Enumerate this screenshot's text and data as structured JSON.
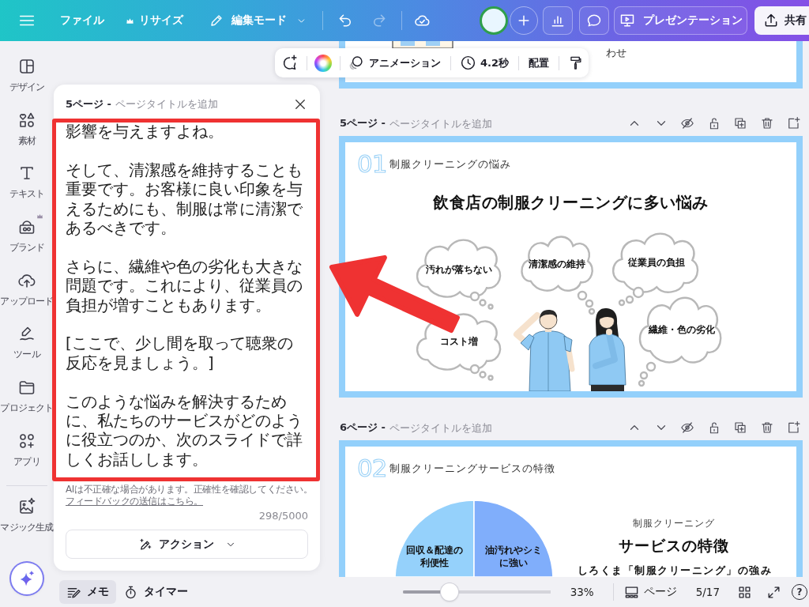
{
  "top_bar": {
    "file_menu": "ファイル",
    "resize_menu": {
      "label": "リサイズ",
      "premium": true
    },
    "edit_mode": "編集モード",
    "undo": {
      "disabled": false
    },
    "redo": {
      "disabled": true
    },
    "present_button": "プレゼンテーション",
    "share_button": "共有"
  },
  "floating_toolbar": {
    "animation": "アニメーション",
    "duration": "4.2秒",
    "position": "配置"
  },
  "sidebar": {
    "items": [
      {
        "label": "デザイン",
        "premium": false
      },
      {
        "label": "素材",
        "premium": false
      },
      {
        "label": "テキスト",
        "premium": false
      },
      {
        "label": "ブランド",
        "premium": true
      },
      {
        "label": "アップロード",
        "premium": false
      },
      {
        "label": "ツール",
        "premium": false
      },
      {
        "label": "プロジェクト",
        "premium": false
      },
      {
        "label": "アプリ",
        "premium": false
      }
    ],
    "ai_items": [
      {
        "label": "マジック生成",
        "premium": false
      }
    ]
  },
  "notes_panel": {
    "page_label": "5ページ -",
    "title_field": {
      "placeholder": "ページタイトルを追加"
    },
    "highlighted": true,
    "paragraphs": [
      "影響を与えますよね。",
      "そして、清潔感を維持することも重要です。お客様に良い印象を与えるためにも、制服は常に清潔であるべきです。",
      "さらに、繊維や色の劣化も大きな問題です。これにより、従業員の負担が増すこともあります。",
      "[ここで、少し間を取って聴衆の反応を見ましょう。]",
      "このような悩みを解決するために、私たちのサービスがどのように役立つのか、次のスライドで詳しくお話しします。"
    ],
    "disclaimer": "AIは不正確な場合があります。正確性を確認してください。",
    "feedback_link": "フィードバックの送信はこちら。",
    "char_count": "298/5000",
    "action_button": "アクション"
  },
  "canvas": {
    "previous_page": {
      "visible_text": "わせ"
    },
    "pages": [
      {
        "page_label": "5ページ -",
        "title_field": {
          "placeholder": "ページタイトルを追加"
        },
        "slide": {
          "kind": "problems",
          "number": "01",
          "section": "制服クリーニングの悩み",
          "title": "飲食店の制服クリーニングに多い悩み",
          "bubbles": [
            "汚れが落ちない",
            "清潔感の維持",
            "従業員の負担",
            "繊維・色の劣化",
            "コスト増"
          ]
        }
      },
      {
        "page_label": "6ページ -",
        "title_field": {
          "placeholder": "ページタイトルを追加"
        },
        "slide": {
          "kind": "features",
          "number": "02",
          "section": "制服クリーニングサービスの特徴",
          "segments": [
            {
              "label": "回収＆配達の利便性",
              "color": "#95d1fb"
            },
            {
              "label": "油汚れやシミに強い",
              "color": "#80aefb"
            }
          ],
          "eyebrow": "制服クリーニング",
          "heading": "サービスの特徴",
          "subheading": "しろくま「制服クリーニング」の強み"
        }
      }
    ]
  },
  "bottom_bar": {
    "tabs": [
      {
        "label": "メモ",
        "selected": true
      },
      {
        "label": "タイマー",
        "selected": false
      }
    ],
    "zoom": {
      "level": 0.32
    },
    "zoom_reading": "33%",
    "pages_button": "ページ",
    "page_counter": "5/17",
    "help_button": "?"
  },
  "annotations": [
    {
      "kind": "arrow"
    }
  ]
}
